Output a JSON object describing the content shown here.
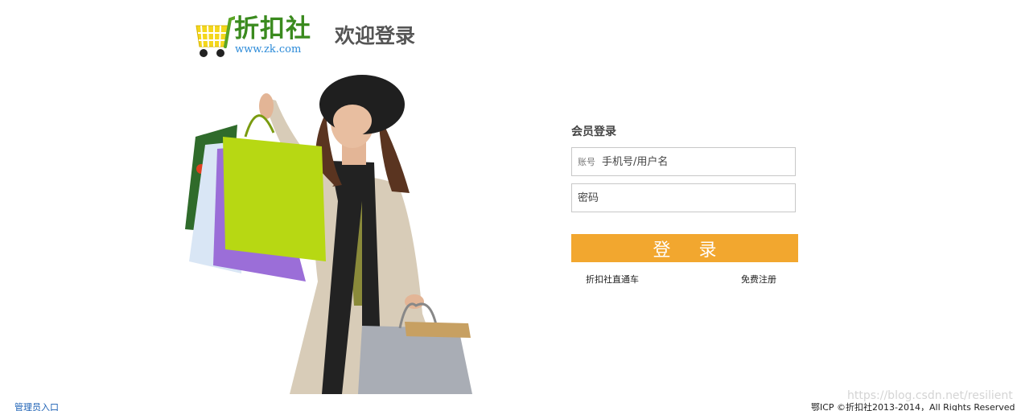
{
  "header": {
    "logo_name": "折扣社",
    "logo_url": "www.zk.com",
    "welcome": "欢迎登录"
  },
  "login": {
    "title": "会员登录",
    "account_label": "账号",
    "account_placeholder": "手机号/用户名",
    "password_placeholder": "密码",
    "submit_label": "登 录",
    "express_link": "折扣社直通车",
    "register_link": "免费注册"
  },
  "footer": {
    "admin_link": "管理员入口",
    "copyright": "鄂ICP ©折扣社2013-2014，All Rights Reserved",
    "watermark": "https://blog.csdn.net/resilient"
  },
  "colors": {
    "brand_green": "#3a8a1e",
    "url_blue": "#2b8ad8",
    "button_orange": "#f2a72f",
    "cart_yellow": "#f4d71c"
  }
}
